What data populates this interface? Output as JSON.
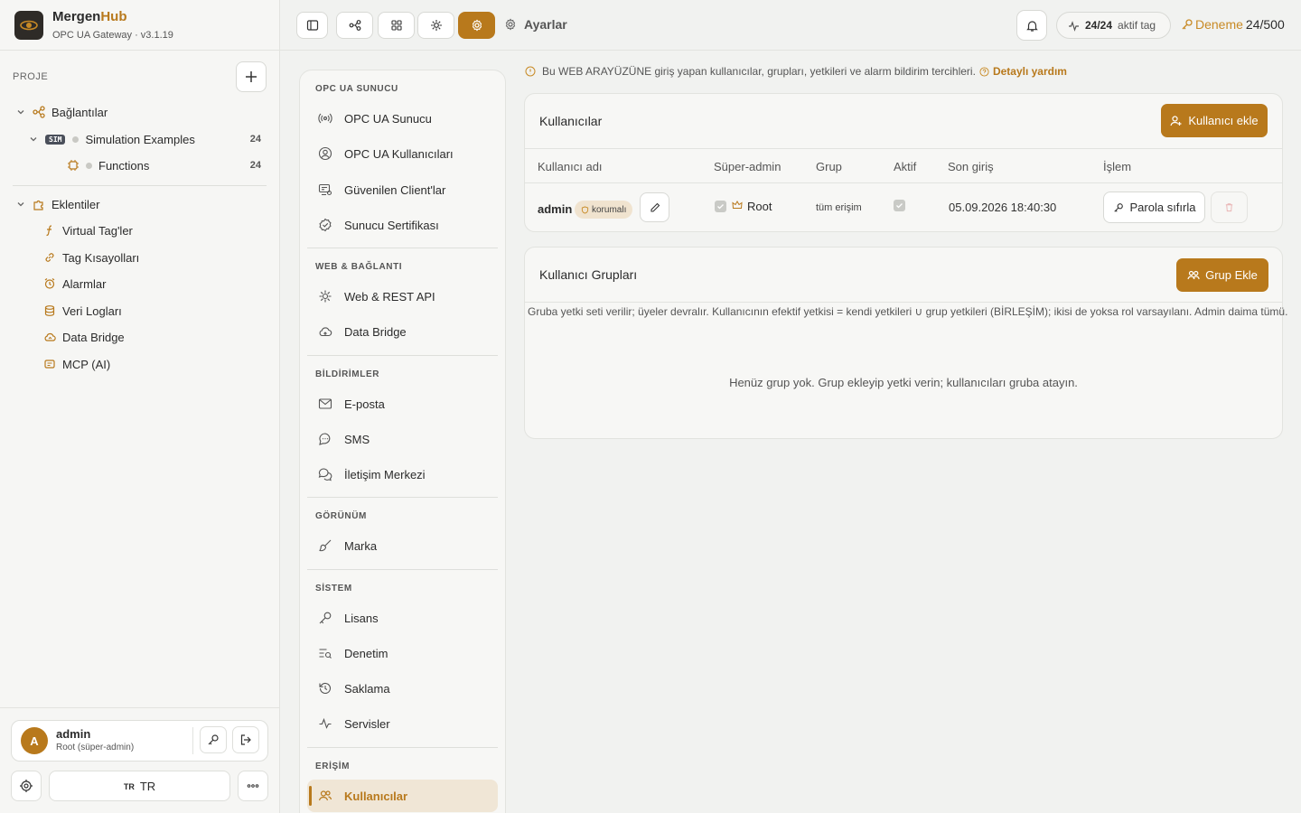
{
  "app": {
    "name_part1": "Mergen",
    "name_part2": "Hub",
    "subtitle": "OPC UA Gateway · v3.1.19"
  },
  "sidebar": {
    "project_label": "PROJE",
    "connections_label": "Bağlantılar",
    "sim_badge": "SIM",
    "sim_name": "Simulation Examples",
    "sim_count": "24",
    "functions_name": "Functions",
    "functions_count": "24",
    "plugins_label": "Eklentiler",
    "plugins": [
      {
        "label": "Virtual Tag'ler",
        "icon": "function-icon"
      },
      {
        "label": "Tag Kısayolları",
        "icon": "link-icon"
      },
      {
        "label": "Alarmlar",
        "icon": "alarm-icon"
      },
      {
        "label": "Veri Logları",
        "icon": "database-icon"
      },
      {
        "label": "Data Bridge",
        "icon": "cloud-sync-icon"
      },
      {
        "label": "MCP (AI)",
        "icon": "ai-chip-icon"
      }
    ],
    "user": {
      "avatar_letter": "A",
      "name": "admin",
      "role": "Root (süper-admin)"
    },
    "language": {
      "small": "TR",
      "label": "TR"
    }
  },
  "topbar": {
    "breadcrumb": "Ayarlar",
    "tag_count": "24/24",
    "tag_label": "aktif tag",
    "trial_label": "Deneme",
    "trial_value": "24/500"
  },
  "settings_nav": {
    "sections": [
      {
        "title": "OPC UA SUNUCU",
        "items": [
          {
            "label": "OPC UA Sunucu",
            "icon": "broadcast-icon"
          },
          {
            "label": "OPC UA Kullanıcıları",
            "icon": "user-circle-icon"
          },
          {
            "label": "Güvenilen Client'lar",
            "icon": "trusted-client-icon"
          },
          {
            "label": "Sunucu Sertifikası",
            "icon": "certificate-icon"
          }
        ]
      },
      {
        "title": "WEB & BAĞLANTI",
        "items": [
          {
            "label": "Web & REST API",
            "icon": "api-icon"
          },
          {
            "label": "Data Bridge",
            "icon": "cloud-sync-icon"
          }
        ]
      },
      {
        "title": "BİLDİRİMLER",
        "items": [
          {
            "label": "E-posta",
            "icon": "mail-icon"
          },
          {
            "label": "SMS",
            "icon": "chat-icon"
          },
          {
            "label": "İletişim Merkezi",
            "icon": "messages-icon"
          }
        ]
      },
      {
        "title": "GÖRÜNÜM",
        "items": [
          {
            "label": "Marka",
            "icon": "brush-icon"
          }
        ]
      },
      {
        "title": "SİSTEM",
        "items": [
          {
            "label": "Lisans",
            "icon": "key-icon"
          },
          {
            "label": "Denetim",
            "icon": "audit-icon"
          },
          {
            "label": "Saklama",
            "icon": "history-icon"
          },
          {
            "label": "Servisler",
            "icon": "activity-icon"
          }
        ]
      },
      {
        "title": "ERİŞİM",
        "items": [
          {
            "label": "Kullanıcılar",
            "icon": "users-icon",
            "active": true
          }
        ]
      }
    ]
  },
  "main": {
    "info_text": "Bu WEB ARAYÜZÜNE giriş yapan kullanıcılar, grupları, yetkileri ve alarm bildirim tercihleri.",
    "help_link": "Detaylı yardım",
    "users_card": {
      "title": "Kullanıcılar",
      "add_button": "Kullanıcı ekle",
      "columns": [
        "Kullanıcı adı",
        "Süper-admin",
        "Grup",
        "Aktif",
        "Son giriş",
        "İşlem"
      ],
      "rows": [
        {
          "username": "admin",
          "badge": "korumalı",
          "super_admin": true,
          "super_admin_label": "Root",
          "group": "tüm erişim",
          "active": true,
          "last_login": "05.09.2026 18:40:30",
          "reset_password": "Parola sıfırla"
        }
      ]
    },
    "groups_card": {
      "title": "Kullanıcı Grupları",
      "add_button": "Grup Ekle",
      "description": "Gruba yetki seti verilir; üyeler devralır. Kullanıcının efektif yetkisi = kendi yetkileri ∪ grup yetkileri (BİRLEŞİM); ikisi de yoksa rol varsayılanı. Admin daima tümü.",
      "empty_text": "Henüz grup yok. Grup ekleyip yetki verin; kullanıcıları gruba atayın."
    }
  },
  "colors": {
    "accent": "#b8791c",
    "trial": "#c88a25",
    "active_bg": "#f0e6d6"
  }
}
